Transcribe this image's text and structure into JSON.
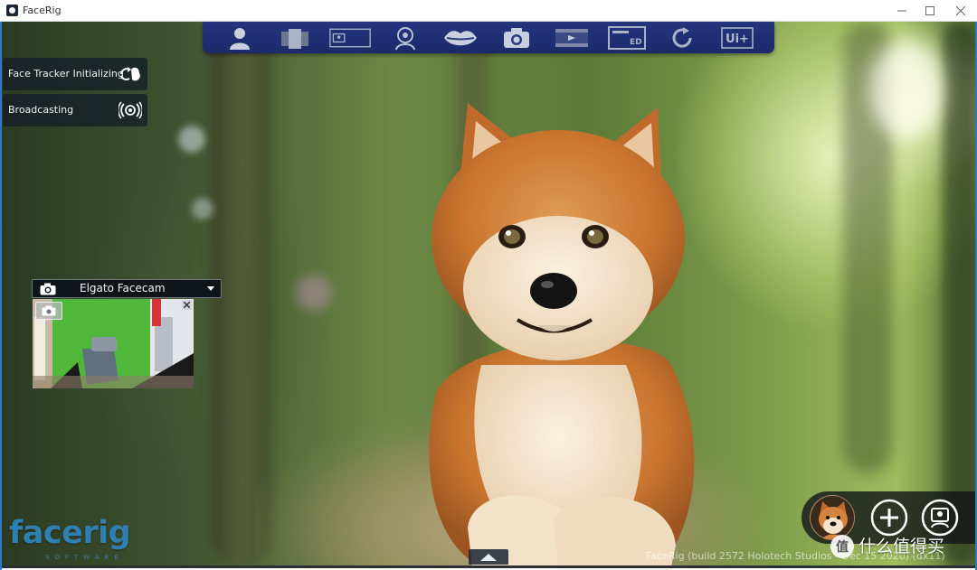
{
  "window": {
    "title": "FaceRig",
    "controls": [
      "minimize",
      "maximize",
      "close"
    ]
  },
  "toolbar": {
    "buttons": [
      {
        "name": "avatars",
        "icon": "person-icon"
      },
      {
        "name": "backgrounds",
        "icon": "layers-icon"
      },
      {
        "name": "scene",
        "icon": "scene-frame-icon"
      },
      {
        "name": "props",
        "icon": "head-icon"
      },
      {
        "name": "lip-sync",
        "icon": "lips-icon"
      },
      {
        "name": "screenshot",
        "icon": "camera-icon"
      },
      {
        "name": "record",
        "icon": "film-icon"
      },
      {
        "name": "advanced-ui",
        "icon": "ed-screen-icon"
      },
      {
        "name": "reset",
        "icon": "refresh-icon"
      },
      {
        "name": "ui-plus",
        "icon": "ui-plus-icon",
        "label": "Ui+"
      }
    ]
  },
  "status": {
    "tracker": {
      "label": "Face Tracker Initializing",
      "icon": "hands-sync-icon"
    },
    "broadcast": {
      "label": "Broadcasting",
      "icon": "broadcast-icon"
    }
  },
  "camera": {
    "selected": "Elgato Facecam",
    "header_icon": "camera-icon",
    "dropdown_icon": "caret-down-icon",
    "close_icon": "close-icon"
  },
  "logo": {
    "text": "facerig",
    "subtitle": "SOFTWARE"
  },
  "build_info": "FaceRig (build 2572 Holotech Studios - Dec 15 2020) (dx11)",
  "avatar_tray": {
    "current_avatar": "shiba-inu-avatar",
    "add_icon": "plus-circle-icon",
    "profile_icon": "profile-circle-icon"
  },
  "watermark": {
    "badge": "值",
    "text": "什么值得买"
  },
  "colors": {
    "toolbar": "#1f2f74",
    "accent": "#2f7fb0",
    "panel": "#161e28"
  }
}
